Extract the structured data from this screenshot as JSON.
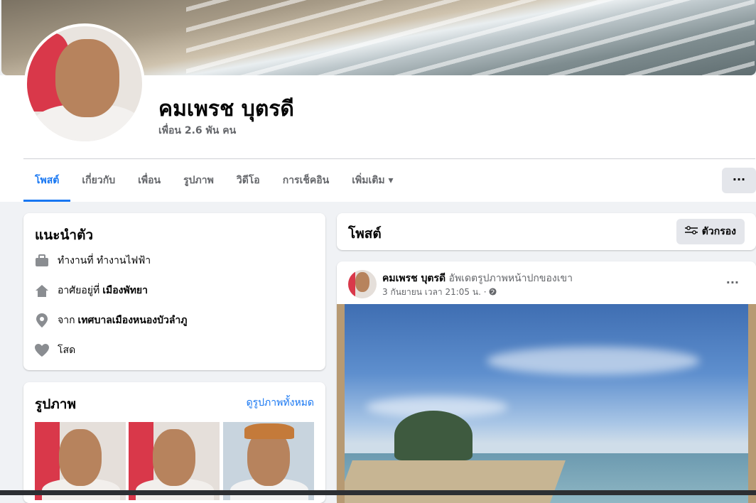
{
  "profile": {
    "name": "คมเพรช บุตรดี",
    "friends": "เพื่อน 2.6 พัน คน"
  },
  "tabs": [
    {
      "label": "โพสต์",
      "active": true
    },
    {
      "label": "เกี่ยวกับ"
    },
    {
      "label": "เพื่อน"
    },
    {
      "label": "รูปภาพ"
    },
    {
      "label": "วิดีโอ"
    },
    {
      "label": "การเช็คอิน"
    },
    {
      "label": "เพิ่มเติม ▾"
    }
  ],
  "more_label": "···",
  "intro": {
    "title": "แนะนำตัว",
    "rows": [
      {
        "icon": "briefcase-icon",
        "prefix": "ทำงานที่ ทำงานไฟฟ้า",
        "bold": ""
      },
      {
        "icon": "home-icon",
        "prefix": "อาศัยอยู่ที่",
        "bold": "เมืองพัทยา"
      },
      {
        "icon": "location-pin-icon",
        "prefix": "จาก",
        "bold": "เทศบาลเมืองหนองบัวลำภู"
      },
      {
        "icon": "heart-icon",
        "prefix": "โสด",
        "bold": ""
      }
    ]
  },
  "photos": {
    "title": "รูปภาพ",
    "see_all": "ดูรูปภาพทั้งหมด"
  },
  "posts": {
    "title": "โพสต์",
    "filter_label": "ตัวกรอง",
    "post": {
      "author": "คมเพรช บุตรดี",
      "action": "อัพเดตรูปภาพหน้าปกของเขา",
      "time": "3 กันยายน เวลา 21:05 น. ·"
    }
  },
  "colors": {
    "accent": "#1877f2",
    "background": "#f0f2f5",
    "secondary_text": "#65676b"
  }
}
